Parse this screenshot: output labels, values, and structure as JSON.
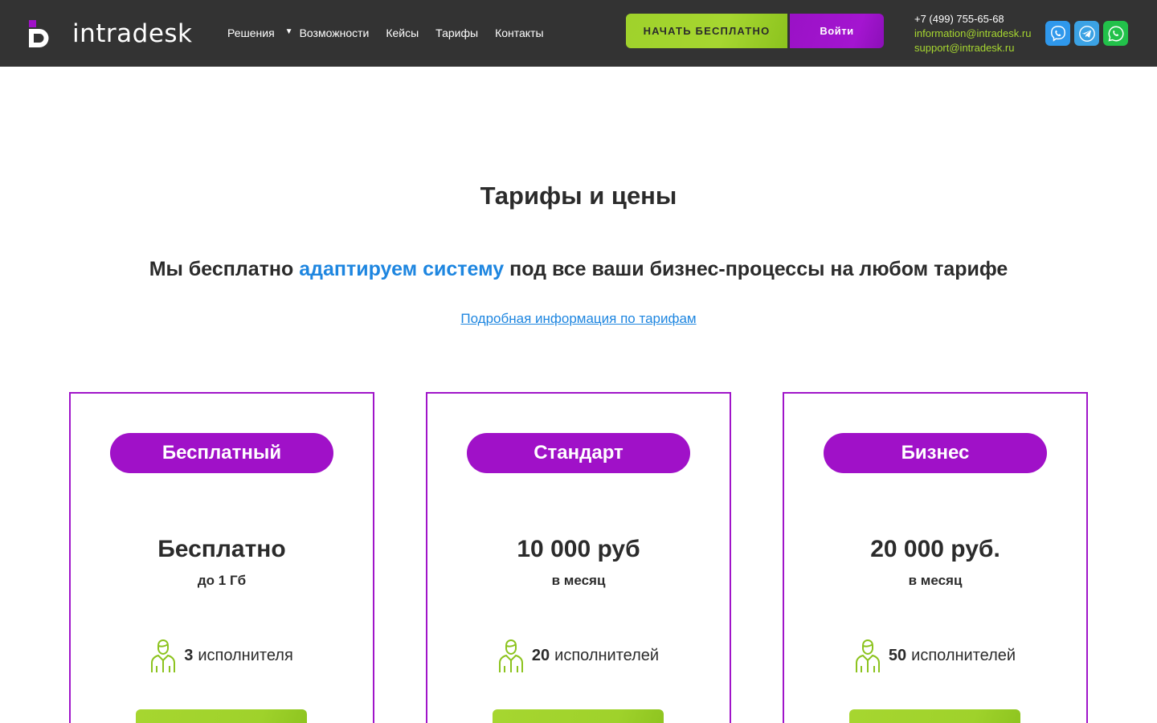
{
  "header": {
    "logo_text": "intradesk",
    "nav": [
      {
        "label": "Решения",
        "has_dropdown": true
      },
      {
        "label": "Возможности"
      },
      {
        "label": "Кейсы"
      },
      {
        "label": "Тарифы"
      },
      {
        "label": "Контакты"
      }
    ],
    "start_button": "НАЧАТЬ БЕСПЛАТНО",
    "login_button": "Войти",
    "phone": "+7 (499) 755-65-68",
    "email_info": "information@intradesk.ru",
    "email_support": "support@intradesk.ru",
    "messengers": [
      "viber-icon",
      "telegram-icon",
      "whatsapp-icon"
    ]
  },
  "main": {
    "title": "Тарифы и цены",
    "subtitle_before": "Мы бесплатно ",
    "subtitle_accent": "адаптируем систему",
    "subtitle_after": " под все ваши бизнес-процессы на любом тарифе",
    "details_link": "Подробная информация по тарифам",
    "plans": [
      {
        "name": "Бесплатный",
        "price": "Бесплатно",
        "period": "до 1 Гб",
        "users_count": "3",
        "users_label": "исполнителя"
      },
      {
        "name": "Стандарт",
        "price": "10 000 руб",
        "period": "в месяц",
        "users_count": "20",
        "users_label": "исполнителей"
      },
      {
        "name": "Бизнес",
        "price": "20 000 руб.",
        "period": "в месяц",
        "users_count": "50",
        "users_label": "исполнителей"
      }
    ]
  },
  "colors": {
    "header_bg": "#333333",
    "accent_green": "#a6d630",
    "accent_purple": "#a011c8",
    "link_blue": "#1e86e0"
  }
}
